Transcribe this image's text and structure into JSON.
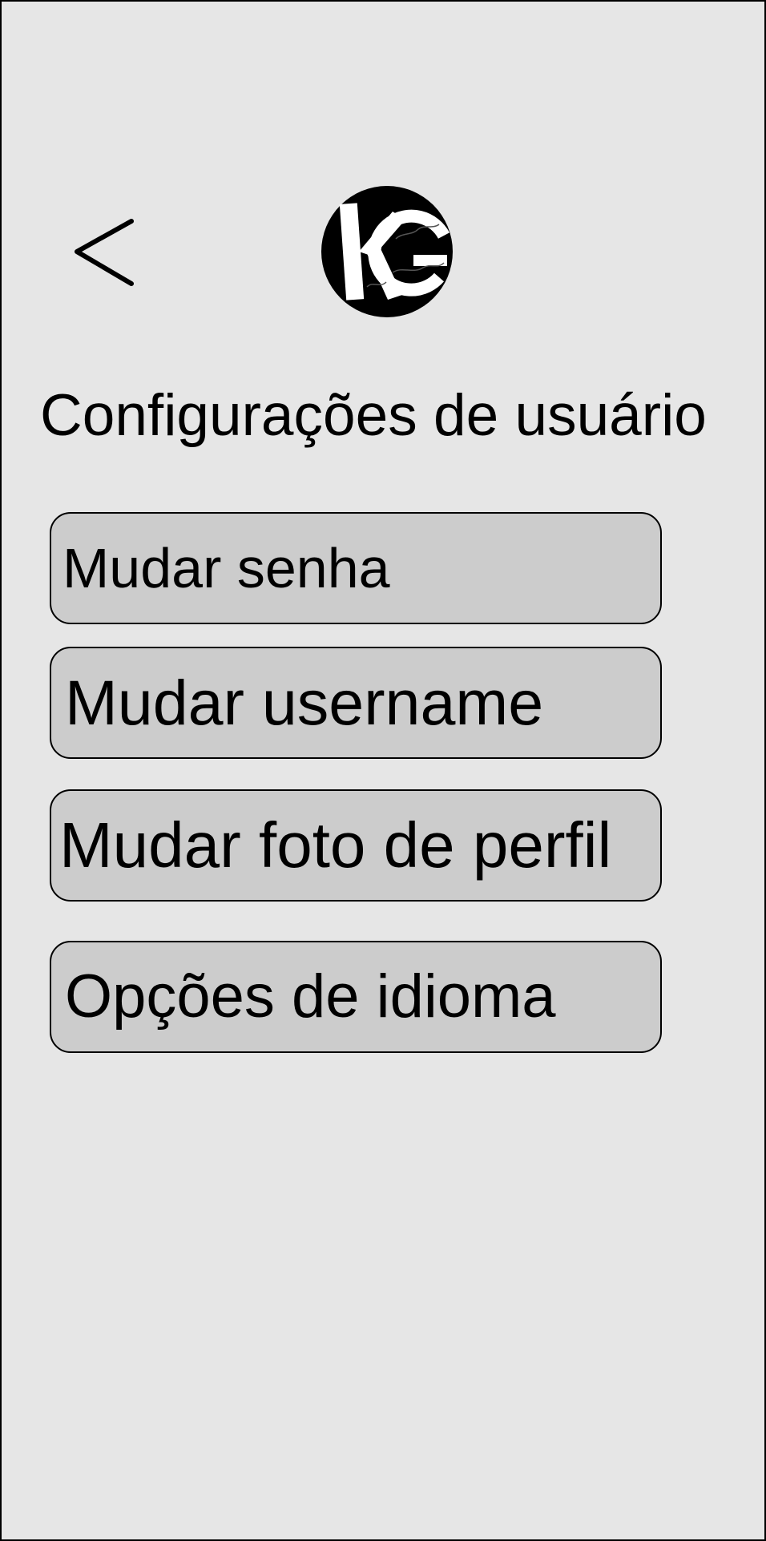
{
  "header": {
    "back_icon": "chevron-left-icon",
    "logo_text": "KG"
  },
  "page": {
    "title": "Configurações de usuário"
  },
  "menu": {
    "items": [
      {
        "label": "Mudar senha"
      },
      {
        "label": "Mudar username"
      },
      {
        "label": "Mudar foto de perfil"
      },
      {
        "label": "Opções de idioma"
      }
    ]
  },
  "colors": {
    "background": "#e6e6e6",
    "button_fill": "#cccccc",
    "border": "#000000",
    "text": "#000000"
  }
}
